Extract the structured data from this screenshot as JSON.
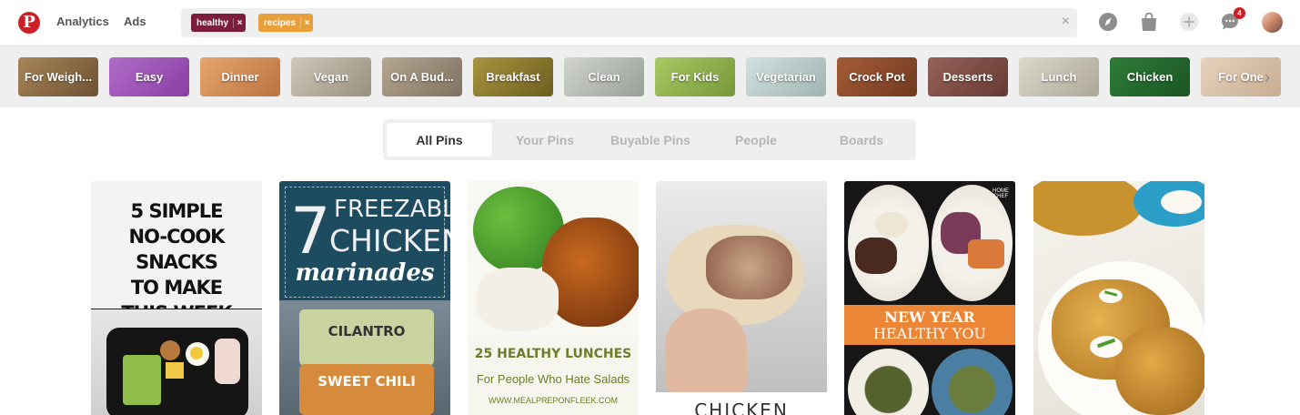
{
  "header": {
    "logo_letter": "P",
    "nav": {
      "analytics": "Analytics",
      "ads": "Ads"
    },
    "search": {
      "tags": [
        {
          "label": "healthy",
          "color": "#7c1d3e"
        },
        {
          "label": "recipes",
          "color": "#e8a13a"
        }
      ],
      "tag_remove": "×",
      "clear": "×"
    },
    "icons": [
      "explore-icon",
      "shopping-bag-icon",
      "add-icon",
      "messages-icon"
    ],
    "notification_count": "4"
  },
  "guides": [
    {
      "label": "For Weigh...",
      "color": "#8e6e45"
    },
    {
      "label": "Easy",
      "color": "#9d4fb4"
    },
    {
      "label": "Dinner",
      "color": "#d18c55"
    },
    {
      "label": "Vegan",
      "color": "#b4ab9b"
    },
    {
      "label": "On A Bud...",
      "color": "#9c8d78"
    },
    {
      "label": "Breakfast",
      "color": "#8c7a2e"
    },
    {
      "label": "Clean",
      "color": "#b5bab4"
    },
    {
      "label": "For Kids",
      "color": "#8fb04c"
    },
    {
      "label": "Vegetarian",
      "color": "#b7c9c7"
    },
    {
      "label": "Crock Pot",
      "color": "#8a4a2c"
    },
    {
      "label": "Desserts",
      "color": "#7d4d44"
    },
    {
      "label": "Lunch",
      "color": "#c6c1b2"
    },
    {
      "label": "Chicken",
      "color": "#226b2d"
    },
    {
      "label": "For One",
      "color": "#d7c0a8"
    }
  ],
  "guides_next": "›",
  "tabs": [
    "All Pins",
    "Your Pins",
    "Buyable Pins",
    "People",
    "Boards"
  ],
  "active_tab": "All Pins",
  "pins": {
    "p1": {
      "lines": [
        "5 SIMPLE",
        "NO-COOK SNACKS",
        "TO MAKE",
        "THIS WEEK"
      ]
    },
    "p2": {
      "number": "7",
      "line1": "FREEZABLE",
      "line2": "CHICKEN",
      "line3": "marinades",
      "bag1": "CILANTRO",
      "bag2": "SWEET CHILI"
    },
    "p3": {
      "title": "25 HEALTHY LUNCHES",
      "subtitle": "For People Who Hate Salads",
      "url": "WWW.MEALPREPONFLEEK.COM"
    },
    "p4": {
      "caption": "CHICKEN"
    },
    "p5": {
      "banner1": "NEW YEAR",
      "banner2": "HEALTHY YOU",
      "brand": "HOME CHEF"
    },
    "p6": {}
  }
}
